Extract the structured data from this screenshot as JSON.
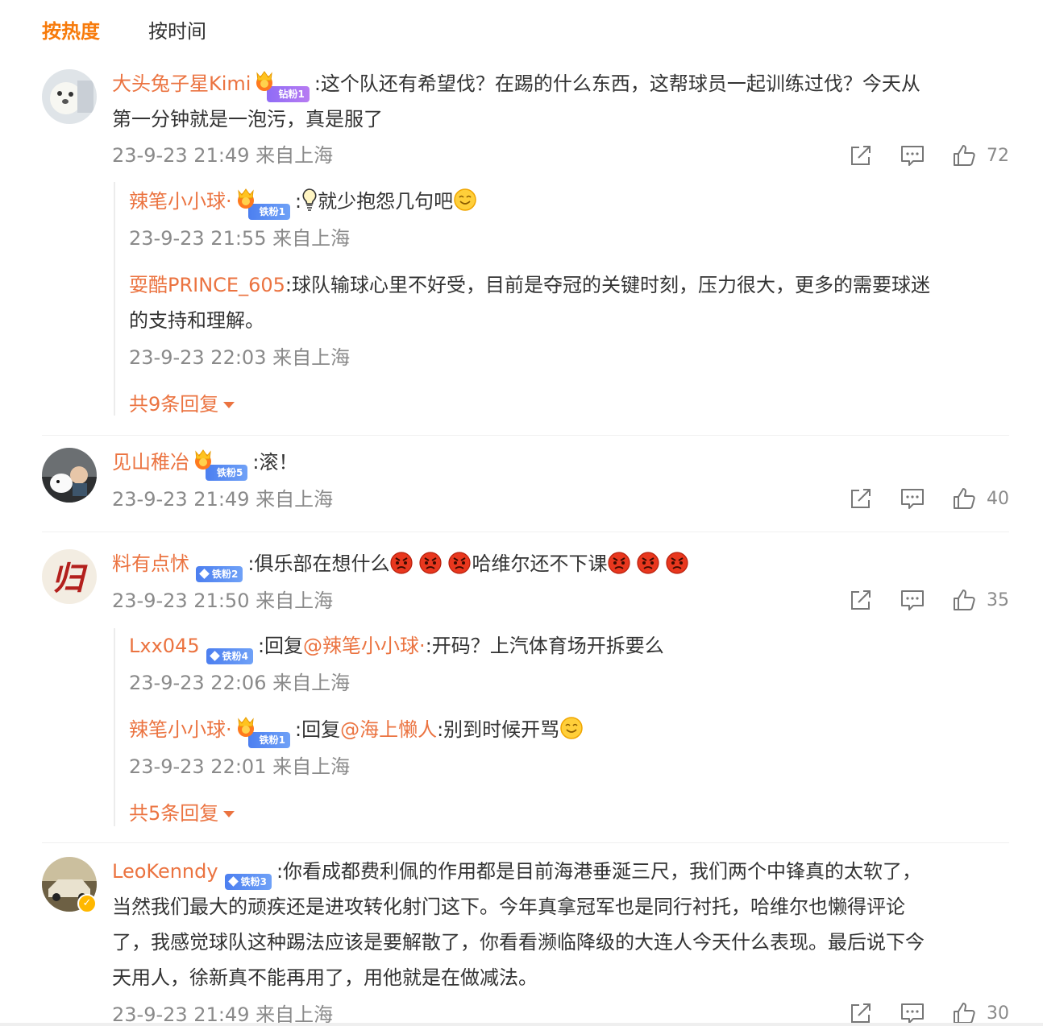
{
  "sort": {
    "hot": "按热度",
    "time": "按时间"
  },
  "comments": [
    {
      "name": "大头兔子星Kimi",
      "badge": "钻粉1",
      "text_part1": ":这个队还有希望伐？在踢的什么东西，这帮球员一起训练过伐？今天从",
      "text_part2": "第一分钟就是一泡污，真是服了",
      "meta": "23-9-23 21:49 来自上海",
      "likes": "72",
      "replies": [
        {
          "name": "辣笔小小球·",
          "badge": "铁粉1",
          "text_a": ":",
          "text_b": "就少抱怨几句吧",
          "meta": "23-9-23 21:55 来自上海"
        },
        {
          "name": "耍酷PRINCE_605",
          "text_part1": ":球队输球心里不好受，目前是夺冠的关键时刻，压力很大，更多的需要球迷",
          "text_part2": "的支持和理解。",
          "meta": "23-9-23 22:03 来自上海"
        }
      ],
      "more": "共9条回复"
    },
    {
      "name": "见山稚冶",
      "badge": "铁粉5",
      "text": ":滚！",
      "meta": "23-9-23 21:49 来自上海",
      "likes": "40"
    },
    {
      "name": "料有点怵",
      "badge": "铁粉2",
      "text_a": ":俱乐部在想什么",
      "text_b": "哈维尔还不下课",
      "meta": "23-9-23 21:50 来自上海",
      "likes": "35",
      "replies": [
        {
          "name": "Lxx045",
          "badge": "铁粉4",
          "prefix": ":回复",
          "mention": "@辣笔小小球·",
          "text": ":开码？上汽体育场开拆要么",
          "meta": "23-9-23 22:06 来自上海"
        },
        {
          "name": "辣笔小小球·",
          "badge": "铁粉1",
          "prefix": ":回复",
          "mention": "@海上懒人",
          "text": ":别到时候开骂",
          "meta": "23-9-23 22:01 来自上海"
        }
      ],
      "more": "共5条回复"
    },
    {
      "name": "LeoKenndy",
      "badge": "铁粉3",
      "line1": ":你看成都费利佩的作用都是目前海港垂涎三尺，我们两个中锋真的太软了，",
      "line2": "当然我们最大的顽疾还是进攻转化射门这下。今年真拿冠军也是同行衬托，哈维尔也懒得评论",
      "line3": "了，我感觉球队这种踢法应该是要解散了，你看看濒临降级的大连人今天什么表现。最后说下今",
      "line4": "天用人，徐新真不能再用了，用他就是在做减法。",
      "meta": "23-9-23 21:49 来自上海",
      "likes": "30"
    }
  ],
  "colors": {
    "accent": "#f77a0a",
    "username": "#eb7340",
    "meta": "#8a8a8a",
    "badge_purple": "#8f6cf6",
    "badge_blue": "#4c7ff0"
  },
  "icons": [
    "share-icon",
    "comment-icon",
    "like-icon",
    "crown-icon",
    "verified-icon",
    "bulb-emoji",
    "smile-emoji",
    "angry-emoji"
  ]
}
